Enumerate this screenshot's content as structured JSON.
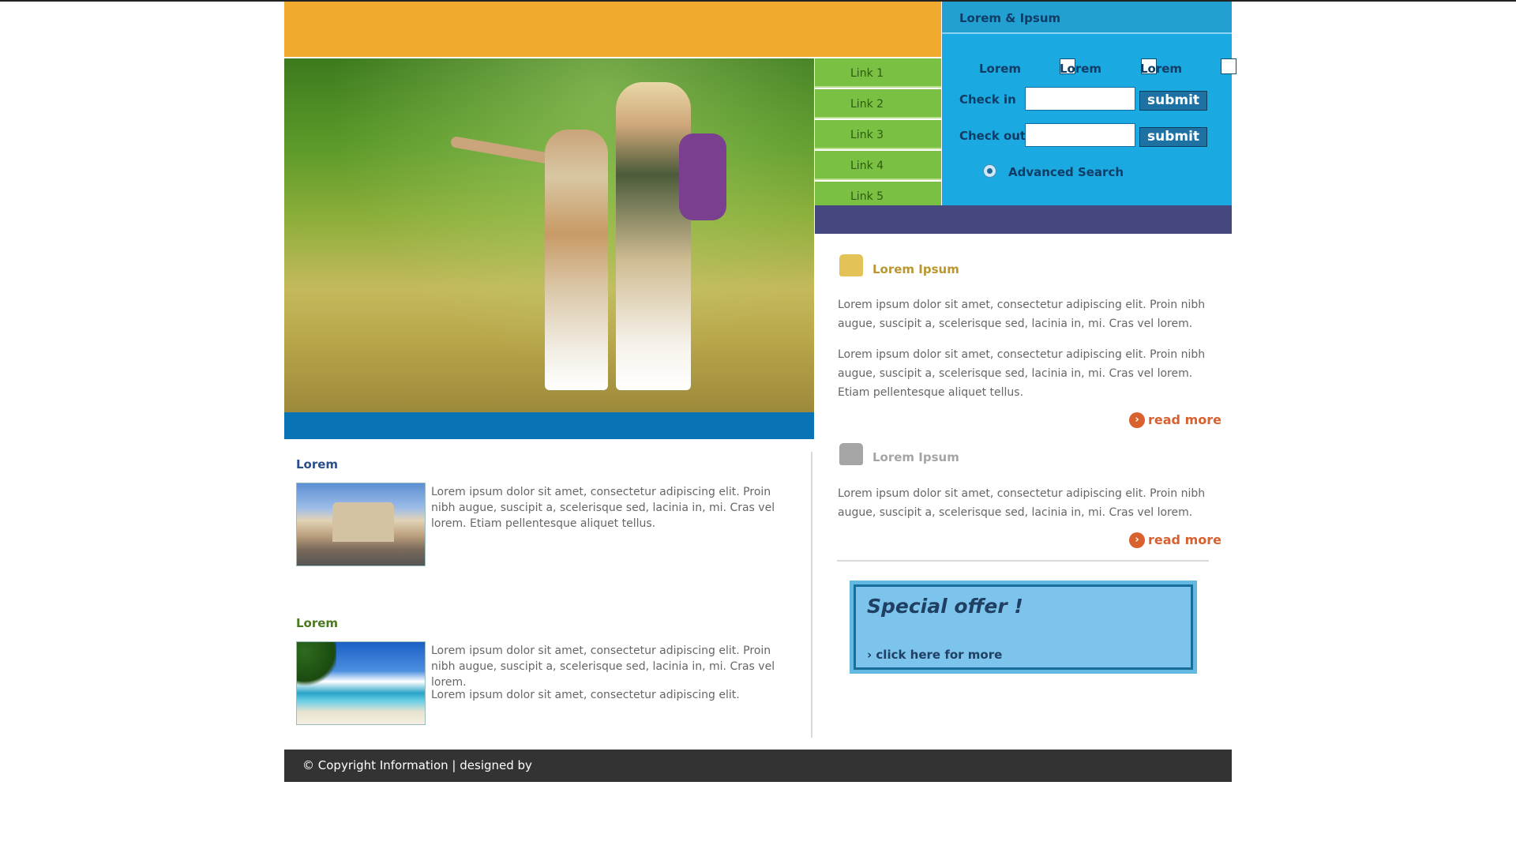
{
  "booking": {
    "title": "Lorem & Ipsum",
    "options": [
      "Lorem",
      "Lorem",
      "Lorem"
    ],
    "check_in_label": "Check in",
    "check_out_label": "Check out",
    "submit_label": "submit",
    "advanced_search": "Advanced Search",
    "color": "#1ba9e1"
  },
  "nav": {
    "items": [
      "Link 1",
      "Link 2",
      "Link 3",
      "Link 4",
      "Link 5"
    ],
    "color": "#7ac143"
  },
  "left": {
    "sections": [
      {
        "title": "Lorem",
        "title_color": "#2a4f8c",
        "paragraphs": [
          "Lorem ipsum dolor sit amet, consectetur adipiscing elit. Proin nibh augue, suscipit a, scelerisque sed, lacinia in, mi. Cras vel lorem. Etiam pellentesque aliquet tellus."
        ]
      },
      {
        "title": "Lorem",
        "title_color": "#4a7a1e",
        "paragraphs": [
          "Lorem ipsum dolor sit amet, consectetur adipiscing elit. Proin nibh augue, suscipit a, scelerisque sed, lacinia in, mi. Cras vel lorem.",
          "Lorem ipsum dolor sit amet, consectetur adipiscing elit."
        ]
      }
    ]
  },
  "right": {
    "articles": [
      {
        "title": "Lorem Ipsum",
        "title_color": "#b9962f",
        "paragraphs": [
          "Lorem ipsum dolor sit amet, consectetur adipiscing elit. Proin nibh augue, suscipit a, scelerisque sed, lacinia in, mi. Cras vel lorem.",
          "Lorem ipsum dolor sit amet, consectetur adipiscing elit. Proin nibh augue, suscipit a, scelerisque sed, lacinia in, mi. Cras vel lorem. Etiam pellentesque aliquet tellus."
        ],
        "read_more": "read more"
      },
      {
        "title": "Lorem Ipsum",
        "title_color": "#a5a5a5",
        "paragraphs": [
          "Lorem ipsum dolor sit amet, consectetur adipiscing elit. Proin nibh augue, suscipit a, scelerisque sed, lacinia in, mi. Cras vel lorem."
        ],
        "read_more": "read more"
      }
    ],
    "offer": {
      "title": "Special offer !",
      "link": "click here for more"
    }
  },
  "footer": {
    "text": "© Copyright Information | designed by"
  },
  "colors": {
    "orange_banner": "#f0aa2e",
    "blue_strip": "#0a73b5",
    "purple_strip": "#45477f",
    "footer": "#333333",
    "read_more": "#d9602f"
  }
}
